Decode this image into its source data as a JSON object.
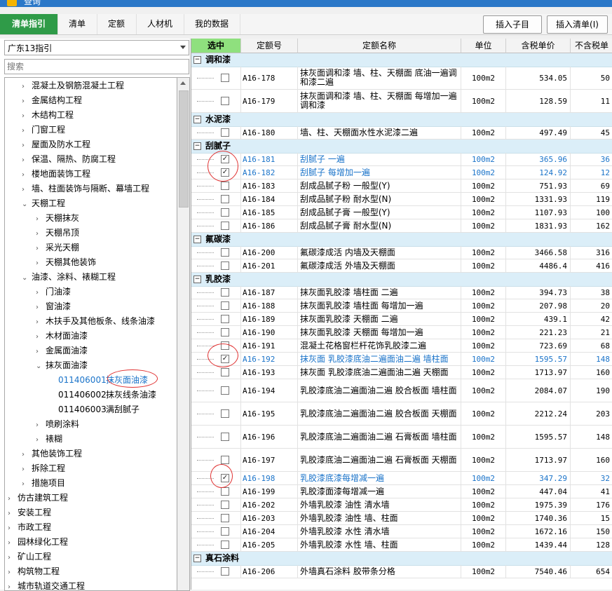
{
  "window": {
    "title": "查询"
  },
  "tabs": [
    "清单指引",
    "清单",
    "定额",
    "人材机",
    "我的数据"
  ],
  "toolbar": {
    "insert_sub": "插入子目",
    "insert_list": "插入清单(I)"
  },
  "left": {
    "region": "广东13指引",
    "search_placeholder": "搜索",
    "tree": [
      {
        "label": "混凝土及钢筋混凝土工程",
        "level": 2,
        "arrow": "›"
      },
      {
        "label": "金属结构工程",
        "level": 2,
        "arrow": "›"
      },
      {
        "label": "木结构工程",
        "level": 2,
        "arrow": "›"
      },
      {
        "label": "门窗工程",
        "level": 2,
        "arrow": "›"
      },
      {
        "label": "屋面及防水工程",
        "level": 2,
        "arrow": "›"
      },
      {
        "label": "保温、隔热、防腐工程",
        "level": 2,
        "arrow": "›"
      },
      {
        "label": "楼地面装饰工程",
        "level": 2,
        "arrow": "›"
      },
      {
        "label": "墙、柱面装饰与隔断、幕墙工程",
        "level": 2,
        "arrow": "›"
      },
      {
        "label": "天棚工程",
        "level": 2,
        "arrow": "⌄"
      },
      {
        "label": "天棚抹灰",
        "level": 3,
        "arrow": "›"
      },
      {
        "label": "天棚吊顶",
        "level": 3,
        "arrow": "›"
      },
      {
        "label": "采光天棚",
        "level": 3,
        "arrow": "›"
      },
      {
        "label": "天棚其他装饰",
        "level": 3,
        "arrow": "›"
      },
      {
        "label": "油漆、涂料、裱糊工程",
        "level": 2,
        "arrow": "⌄"
      },
      {
        "label": "门油漆",
        "level": 3,
        "arrow": "›"
      },
      {
        "label": "窗油漆",
        "level": 3,
        "arrow": "›"
      },
      {
        "label": "木扶手及其他板条、线条油漆",
        "level": 3,
        "arrow": "›"
      },
      {
        "label": "木材面油漆",
        "level": 3,
        "arrow": "›"
      },
      {
        "label": "金属面油漆",
        "level": 3,
        "arrow": "›"
      },
      {
        "label": "抹灰面油漆",
        "level": 3,
        "arrow": "⌄"
      },
      {
        "code": "011406001",
        "label": "抹灰面油漆",
        "level": 4,
        "arrow": "",
        "selected": true
      },
      {
        "code": "011406002",
        "label": "抹灰线条油漆",
        "level": 4,
        "arrow": ""
      },
      {
        "code": "011406003",
        "label": "满刮腻子",
        "level": 4,
        "arrow": ""
      },
      {
        "label": "喷刷涂料",
        "level": 3,
        "arrow": "›"
      },
      {
        "label": "裱糊",
        "level": 3,
        "arrow": "›"
      },
      {
        "label": "其他装饰工程",
        "level": 2,
        "arrow": "›"
      },
      {
        "label": "拆除工程",
        "level": 2,
        "arrow": "›"
      },
      {
        "label": "措施项目",
        "level": 2,
        "arrow": "›"
      },
      {
        "label": "仿古建筑工程",
        "level": 1,
        "arrow": "›"
      },
      {
        "label": "安装工程",
        "level": 1,
        "arrow": "›"
      },
      {
        "label": "市政工程",
        "level": 1,
        "arrow": "›"
      },
      {
        "label": "园林绿化工程",
        "level": 1,
        "arrow": "›"
      },
      {
        "label": "矿山工程",
        "level": 1,
        "arrow": "›"
      },
      {
        "label": "构筑物工程",
        "level": 1,
        "arrow": "›"
      },
      {
        "label": "城市轨道交通工程",
        "level": 1,
        "arrow": "›"
      }
    ]
  },
  "grid": {
    "headers": [
      "选中",
      "定额号",
      "定额名称",
      "单位",
      "含税单价",
      "不含税单"
    ],
    "groups": [
      {
        "title": "调和漆",
        "rows": [
          {
            "code": "A16-178",
            "name": "抹灰面调和漆 墙、柱、天棚面 底油一遍调和漆二遍",
            "unit": "100m2",
            "price": "534.05",
            "price2": "50",
            "checked": false,
            "tall": true
          },
          {
            "code": "A16-179",
            "name": "抹灰面调和漆 墙、柱、天棚面 每增加一遍调和漆",
            "unit": "100m2",
            "price": "128.59",
            "price2": "11",
            "checked": false,
            "tall": true
          }
        ]
      },
      {
        "title": "水泥漆",
        "rows": [
          {
            "code": "A16-180",
            "name": "墙、柱、天棚面水性水泥漆二遍",
            "unit": "100m2",
            "price": "497.49",
            "price2": "45",
            "checked": false
          }
        ]
      },
      {
        "title": "刮腻子",
        "rows": [
          {
            "code": "A16-181",
            "name": "刮腻子 一遍",
            "unit": "100m2",
            "price": "365.96",
            "price2": "36",
            "checked": true
          },
          {
            "code": "A16-182",
            "name": "刮腻子 每增加一遍",
            "unit": "100m2",
            "price": "124.92",
            "price2": "12",
            "checked": true
          },
          {
            "code": "A16-183",
            "name": "刮成品腻子粉 一般型(Y)",
            "unit": "100m2",
            "price": "751.93",
            "price2": "69",
            "checked": false
          },
          {
            "code": "A16-184",
            "name": "刮成品腻子粉 耐水型(N)",
            "unit": "100m2",
            "price": "1331.93",
            "price2": "119",
            "checked": false
          },
          {
            "code": "A16-185",
            "name": "刮成品腻子膏 一般型(Y)",
            "unit": "100m2",
            "price": "1107.93",
            "price2": "100",
            "checked": false
          },
          {
            "code": "A16-186",
            "name": "刮成品腻子膏 耐水型(N)",
            "unit": "100m2",
            "price": "1831.93",
            "price2": "162",
            "checked": false
          }
        ]
      },
      {
        "title": "氟碳漆",
        "rows": [
          {
            "code": "A16-200",
            "name": "氟碳漆成活 内墙及天棚面",
            "unit": "100m2",
            "price": "3466.58",
            "price2": "316",
            "checked": false
          },
          {
            "code": "A16-201",
            "name": "氟碳漆成活 外墙及天棚面",
            "unit": "100m2",
            "price": "4486.4",
            "price2": "416",
            "checked": false
          }
        ]
      },
      {
        "title": "乳胶漆",
        "rows": [
          {
            "code": "A16-187",
            "name": "抹灰面乳胶漆 墙柱面 二遍",
            "unit": "100m2",
            "price": "394.73",
            "price2": "38",
            "checked": false
          },
          {
            "code": "A16-188",
            "name": "抹灰面乳胶漆 墙柱面 每增加一遍",
            "unit": "100m2",
            "price": "207.98",
            "price2": "20",
            "checked": false
          },
          {
            "code": "A16-189",
            "name": "抹灰面乳胶漆 天棚面 二遍",
            "unit": "100m2",
            "price": "439.1",
            "price2": "42",
            "checked": false
          },
          {
            "code": "A16-190",
            "name": "抹灰面乳胶漆 天棚面 每增加一遍",
            "unit": "100m2",
            "price": "221.23",
            "price2": "21",
            "checked": false
          },
          {
            "code": "A16-191",
            "name": "混凝土花格窗栏杆花饰乳胶漆二遍",
            "unit": "100m2",
            "price": "723.69",
            "price2": "68",
            "checked": false
          },
          {
            "code": "A16-192",
            "name": "抹灰面 乳胶漆底油二遍面油二遍 墙柱面",
            "unit": "100m2",
            "price": "1595.57",
            "price2": "148",
            "checked": true
          },
          {
            "code": "A16-193",
            "name": "抹灰面 乳胶漆底油二遍面油二遍 天棚面",
            "unit": "100m2",
            "price": "1713.97",
            "price2": "160",
            "checked": false
          },
          {
            "code": "A16-194",
            "name": "乳胶漆底油二遍面油二遍 胶合板面 墙柱面",
            "unit": "100m2",
            "price": "2084.07",
            "price2": "190",
            "checked": false,
            "tall": true
          },
          {
            "code": "A16-195",
            "name": "乳胶漆底油二遍面油二遍 胶合板面 天棚面",
            "unit": "100m2",
            "price": "2212.24",
            "price2": "203",
            "checked": false,
            "tall": true
          },
          {
            "code": "A16-196",
            "name": "乳胶漆底油二遍面油二遍 石膏板面 墙柱面",
            "unit": "100m2",
            "price": "1595.57",
            "price2": "148",
            "checked": false,
            "tall": true
          },
          {
            "code": "A16-197",
            "name": "乳胶漆底油二遍面油二遍 石膏板面 天棚面",
            "unit": "100m2",
            "price": "1713.97",
            "price2": "160",
            "checked": false,
            "tall": true
          },
          {
            "code": "A16-198",
            "name": "乳胶漆底漆每增减一遍",
            "unit": "100m2",
            "price": "347.29",
            "price2": "32",
            "checked": true
          },
          {
            "code": "A16-199",
            "name": "乳胶漆面漆每增减一遍",
            "unit": "100m2",
            "price": "447.04",
            "price2": "41",
            "checked": false
          },
          {
            "code": "A16-202",
            "name": "外墙乳胶漆 油性 清水墙",
            "unit": "100m2",
            "price": "1975.39",
            "price2": "176",
            "checked": false
          },
          {
            "code": "A16-203",
            "name": "外墙乳胶漆 油性 墙、柱面",
            "unit": "100m2",
            "price": "1740.36",
            "price2": "15",
            "checked": false
          },
          {
            "code": "A16-204",
            "name": "外墙乳胶漆 水性 清水墙",
            "unit": "100m2",
            "price": "1672.16",
            "price2": "150",
            "checked": false
          },
          {
            "code": "A16-205",
            "name": "外墙乳胶漆 水性 墙、柱面",
            "unit": "100m2",
            "price": "1439.44",
            "price2": "128",
            "checked": false
          }
        ]
      },
      {
        "title": "真石涂料",
        "rows": [
          {
            "code": "A16-206",
            "name": "外墙真石涂料 胶带条分格",
            "unit": "100m2",
            "price": "7540.46",
            "price2": "654",
            "checked": false
          }
        ]
      }
    ]
  },
  "colors": {
    "accent": "#2f9b48",
    "highlight": "#1a73c9",
    "group_bg": "#dbeef8",
    "annotation": "#e03030"
  }
}
